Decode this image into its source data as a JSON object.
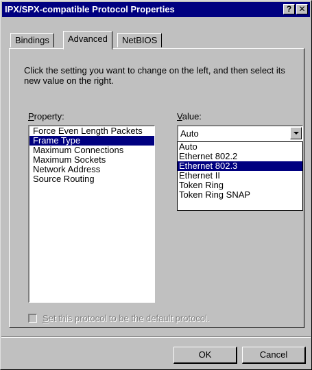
{
  "window": {
    "title": "IPX/SPX-compatible Protocol Properties",
    "help_glyph": "?",
    "close_glyph": "✕"
  },
  "tabs": [
    {
      "label": "Bindings",
      "active": false
    },
    {
      "label": "Advanced",
      "active": true
    },
    {
      "label": "NetBIOS",
      "active": false
    }
  ],
  "description": "Click the setting you want to change on the left, and then select its new value on the right.",
  "property": {
    "label_mnemonic": "P",
    "label_rest": "roperty:",
    "items": [
      "Force Even Length Packets",
      "Frame Type",
      "Maximum Connections",
      "Maximum Sockets",
      "Network Address",
      "Source Routing"
    ],
    "selected": "Frame Type"
  },
  "value": {
    "label_mnemonic": "V",
    "label_rest": "alue:",
    "current": "Auto",
    "options": [
      "Auto",
      "Ethernet 802.2",
      "Ethernet 802.3",
      "Ethernet II",
      "Token Ring",
      "Token Ring SNAP"
    ],
    "highlighted": "Ethernet 802.3"
  },
  "default_checkbox": {
    "mnemonic": "S",
    "rest": "et this protocol to be the default protocol.",
    "checked": false,
    "enabled": false
  },
  "buttons": {
    "ok": "OK",
    "cancel": "Cancel"
  }
}
